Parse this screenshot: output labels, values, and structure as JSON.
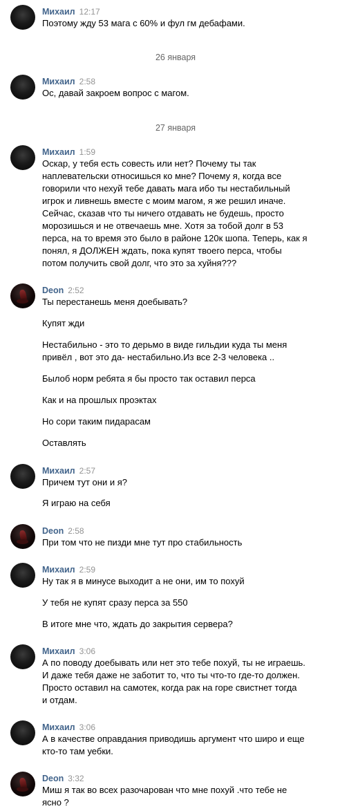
{
  "colors": {
    "author_name": "#42648b",
    "timestamp": "#939393",
    "date_separator": "#656565",
    "message_text": "#000000",
    "background": "#ffffff"
  },
  "date_separators": [
    "26 января",
    "27 января"
  ],
  "messages": [
    {
      "author": "Михаил",
      "avatar_icon": "dark-orb-avatar",
      "time": "12:17",
      "lines": [
        "Поэтому жду 53 мага с 60% и фул гм дебафами."
      ]
    },
    {
      "author": "Михаил",
      "avatar_icon": "dark-orb-avatar",
      "time": "2:58",
      "lines": [
        "Ос, давай закроем вопрос с магом."
      ]
    },
    {
      "author": "Михаил",
      "avatar_icon": "dark-orb-avatar",
      "time": "1:59",
      "lines": [
        "Оскар, у тебя есть совесть или нет? Почему ты так",
        "наплевательски относишься ко мне? Почему я, когда все",
        "говорили что нехуй тебе давать мага ибо ты нестабильный",
        "игрок и ливнешь вместе с моим магом, я же решил иначе.",
        "Сейчас, сказав что ты ничего отдавать не будешь, просто",
        "морозишься и не отвечаешь мне. Хотя за тобой долг в 53",
        "перса, на то время это было в районе 120к шопа. Теперь, как я",
        "понял, я ДОЛЖЕН ждать, пока купят твоего перса, чтобы",
        "потом получить свой долг, что это за хуйня???"
      ]
    },
    {
      "author": "Deon",
      "avatar_icon": "red-figure-avatar",
      "time": "2:52",
      "lines": [
        "Ты перестанешь меня доебывать?",
        "Купят жди",
        "Нестабильно - это то дерьмо в виде гильдии куда ты меня",
        "привёл , вот это да- нестабильно.Из все 2-3 человека ..",
        "Былоб норм ребята я бы просто так оставил перса",
        "Как и на прошлых проэктах",
        "Но сори таким пидарасам",
        "Оставлять"
      ]
    },
    {
      "author": "Михаил",
      "avatar_icon": "dark-orb-avatar",
      "time": "2:57",
      "lines": [
        "Причем тут они и я?",
        "Я играю на себя"
      ]
    },
    {
      "author": "Deon",
      "avatar_icon": "red-figure-avatar",
      "time": "2:58",
      "lines": [
        "При том что не пизди мне тут про стабильность"
      ]
    },
    {
      "author": "Михаил",
      "avatar_icon": "dark-orb-avatar",
      "time": "2:59",
      "lines": [
        "Ну так я в минусе выходит а не они, им то похуй",
        "У тебя не купят сразу перса за 550",
        "В итоге мне что, ждать до закрытия сервера?"
      ]
    },
    {
      "author": "Михаил",
      "avatar_icon": "dark-orb-avatar",
      "time": "3:06",
      "lines": [
        "А по поводу доебывать или нет это тебе похуй, ты не играешь.",
        "И даже тебя даже не заботит то, что ты что-то где-то должен.",
        "Просто оставил на самотек, когда рак на горе свистнет тогда",
        "и отдам."
      ]
    },
    {
      "author": "Михаил",
      "avatar_icon": "dark-orb-avatar",
      "time": "3:06",
      "lines": [
        "А в качестве оправдания приводишь аргумент что широ и еще",
        "кто-то там уебки."
      ]
    },
    {
      "author": "Deon",
      "avatar_icon": "red-figure-avatar",
      "time": "3:32",
      "lines": [
        "Миш я так во всех разочарован что мне похуй .что тебе не",
        "ясно ?"
      ]
    }
  ]
}
